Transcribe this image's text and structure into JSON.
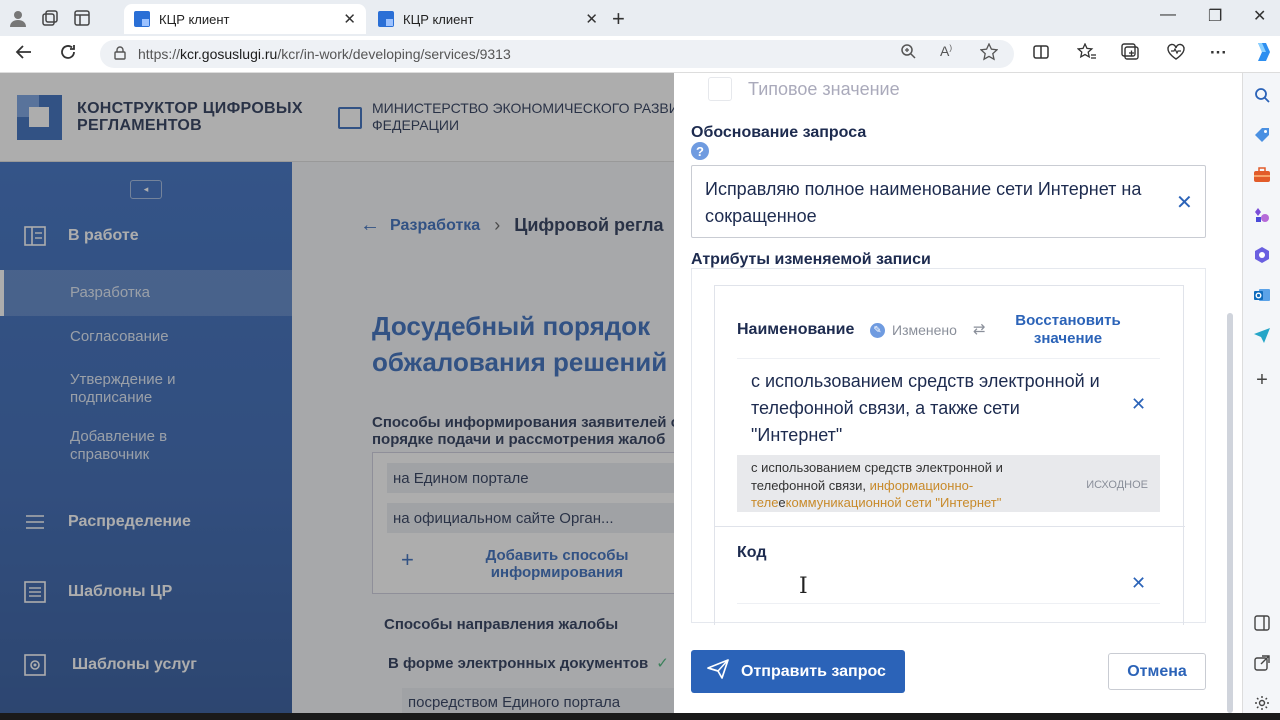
{
  "browser": {
    "tabs": [
      {
        "title": "КЦР клиент",
        "active": true
      },
      {
        "title": "КЦР клиент",
        "active": false
      }
    ],
    "url_prefix": "https://",
    "url_host": "kcr.gosuslugi.ru",
    "url_path": "/kcr/in-work/developing/services/9313",
    "new_tab": "+",
    "window_controls": [
      "—",
      "❐",
      "✕"
    ],
    "toolbar_icons": [
      "split-icon",
      "favorites-icon",
      "collections-icon",
      "health-icon",
      "more-icon",
      "copilot-icon"
    ]
  },
  "header": {
    "logo_line1": "КОНСТРУКТОР ЦИФРОВЫХ",
    "logo_line2": "РЕГЛАМЕНТОВ",
    "ministry_line1": "МИНИСТЕРСТВО ЭКОНОМИЧЕСКОГО РАЗВИТ",
    "ministry_line2": "ФЕДЕРАЦИИ"
  },
  "sidebar": {
    "collapse": "◂",
    "in_work": "В работе",
    "sub_items": [
      "Разработка",
      "Согласование",
      "Утверждение и подписание",
      "Добавление в справочник"
    ],
    "distribution": "Распределение",
    "templates_cr": "Шаблоны ЦР",
    "templates_services": "Шаблоны услуг"
  },
  "main": {
    "crumb_back": "←",
    "crumb_1": "Разработка",
    "crumb_sep": "›",
    "crumb_2": "Цифровой регла",
    "title": "Досудебный порядок обжалования решений",
    "inform_label": "Способы информирования заявителей о порядке подачи и рассмотрения жалоб",
    "chips": [
      "на Едином портале",
      "на официальном сайте Орган..."
    ],
    "add_plus": "+",
    "add_label": "Добавить способы информирования",
    "complaint_label": "Способы направления жалобы",
    "electronic_label": "В форме электронных документов",
    "check": "✓",
    "chip_bottom": "посредством Единого портала"
  },
  "panel": {
    "typical_value": "Типовое значение",
    "reason_title": "Обоснование запроса",
    "help": "?",
    "reason_value": "Исправляю полное наименование сети Интернет на сокращенное",
    "clear": "✕",
    "attrs_title": "Атрибуты изменяемой записи",
    "attr_name_label": "Наименование",
    "changed_label": "Изменено",
    "restore_label": "Восстановить значение",
    "name_value": "с использованием средств электронной и телефонной связи, а также сети \"Интернет\"",
    "orig_part1": "с использованием средств электронной и телефонной связи, ",
    "orig_hl1": "информационно-",
    "orig_hl2": "теле",
    "orig_mid": "е",
    "orig_hl3": "коммуникационной сети \"Интернет\"",
    "orig_tag": "Исходное",
    "code_label": "Код",
    "caret": "I",
    "send_label": "Отправить запрос",
    "cancel_label": "Отмена"
  }
}
